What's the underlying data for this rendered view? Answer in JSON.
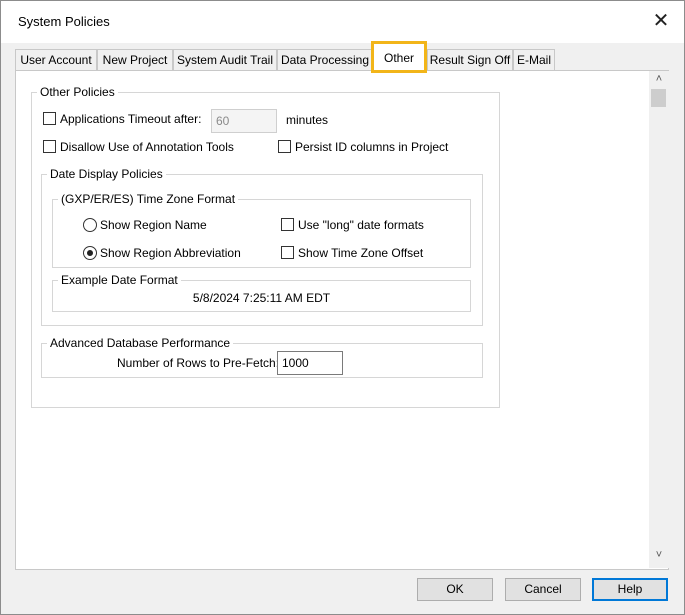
{
  "window": {
    "title": "System Policies",
    "close_symbol": "✕"
  },
  "tabs": [
    {
      "label": "User Account"
    },
    {
      "label": "New Project"
    },
    {
      "label": "System Audit Trail"
    },
    {
      "label": "Data Processing"
    },
    {
      "label": "Other",
      "active": true
    },
    {
      "label": "Result Sign Off"
    },
    {
      "label": "E-Mail"
    }
  ],
  "other_policies": {
    "group_label": "Other Policies",
    "app_timeout": {
      "label": "Applications Timeout after:",
      "checked": false,
      "value": "60",
      "unit": "minutes"
    },
    "disallow_annotation": {
      "label": "Disallow Use of Annotation Tools",
      "checked": false
    },
    "persist_id": {
      "label": "Persist ID columns in Project",
      "checked": false
    }
  },
  "date_display": {
    "group_label": "Date Display Policies",
    "timezone_group_label": "(GXP/ER/ES) Time Zone Format",
    "show_region_name": {
      "label": "Show Region Name",
      "selected": false
    },
    "show_region_abbrev": {
      "label": "Show Region Abbreviation",
      "selected": true
    },
    "use_long_dates": {
      "label": "Use \"long\" date formats",
      "checked": false
    },
    "show_tz_offset": {
      "label": "Show Time Zone Offset",
      "checked": false
    },
    "example_group_label": "Example Date Format",
    "example_value": "5/8/2024 7:25:11 AM EDT"
  },
  "advanced_db": {
    "group_label": "Advanced Database Performance",
    "rows_label": "Number of Rows to Pre-Fetch:",
    "rows_value": "1000"
  },
  "scrollbar": {
    "up": "˄",
    "down": "˅"
  },
  "buttons": {
    "ok": "OK",
    "cancel": "Cancel",
    "help": "Help"
  },
  "colors": {
    "highlight": "#f2b519",
    "default_button_border": "#0078d7"
  }
}
